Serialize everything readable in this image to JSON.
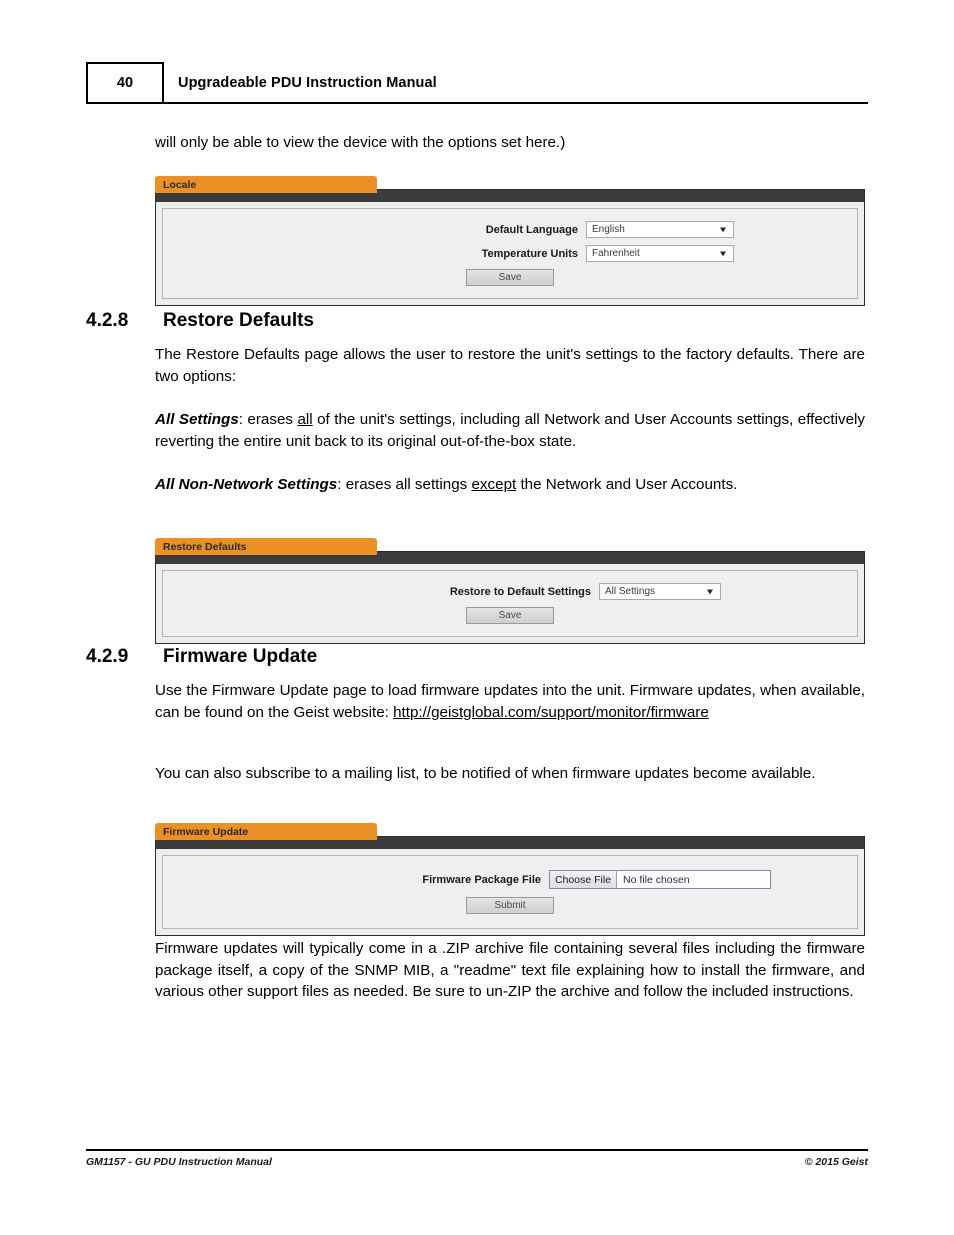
{
  "header": {
    "page_number": "40",
    "title": "Upgradeable PDU Instruction Manual"
  },
  "intro_paragraph": "will only be able to view the device with the options set here.)",
  "locale_panel": {
    "tab_label": "Locale",
    "fields": [
      {
        "label": "Default Language",
        "value": "English"
      },
      {
        "label": "Temperature Units",
        "value": "Fahrenheit"
      }
    ],
    "save_label": "Save"
  },
  "section_restore": {
    "number": "4.2.8",
    "title": "Restore Defaults",
    "paragraph1": "The Restore Defaults page allows the user to restore the unit's settings to the factory defaults. There are two options:",
    "all_settings": {
      "term": "All Settings",
      "before": ": erases ",
      "underlined": "all",
      "after": " of the unit's settings, including all Network and User Accounts settings, effectively reverting the entire unit back to its original out-of-the-box state."
    },
    "all_non_network": {
      "term": "All Non-Network Settings",
      "before": ": erases all settings ",
      "underlined": "except",
      "after": " the Network and User Accounts."
    }
  },
  "restore_panel": {
    "tab_label": "Restore Defaults",
    "field_label": "Restore to Default Settings",
    "field_value": "All Settings",
    "save_label": "Save"
  },
  "section_firmware": {
    "number": "4.2.9",
    "title": "Firmware Update",
    "paragraph1_before": "Use the Firmware Update page to load firmware updates into the unit.  Firmware updates, when available, can be found on the Geist website: ",
    "paragraph1_link": "http://geistglobal.com/support/monitor/firmware",
    "paragraph2": "You can also subscribe to a mailing list, to be notified of when firmware updates become available.",
    "paragraph3": "Firmware updates will typically come in a .ZIP archive file containing several files including the firmware package itself, a copy of the SNMP MIB, a \"readme\" text file explaining how to install the firmware, and various other support files as needed.  Be sure to un-ZIP the archive and follow the included instructions."
  },
  "firmware_panel": {
    "tab_label": "Firmware Update",
    "field_label": "Firmware Package File",
    "choose_file_label": "Choose File",
    "file_name_label": "No file chosen",
    "submit_label": "Submit"
  },
  "footer": {
    "left": "GM1157 - GU PDU Instruction Manual",
    "right": "© 2015 Geist"
  },
  "colors": {
    "accent_orange": "#ea9025",
    "panel_dark": "#3b3b3b"
  }
}
